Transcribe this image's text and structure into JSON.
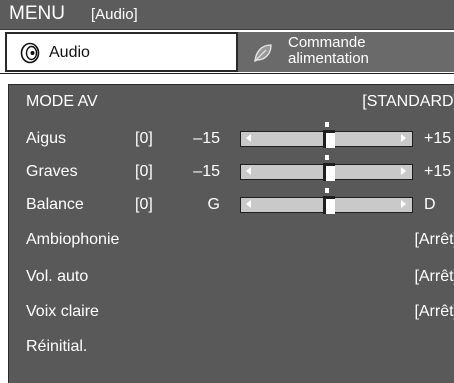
{
  "title_bar": {
    "menu": "MENU",
    "submenu": "[Audio]"
  },
  "tabs": [
    {
      "label": "Audio",
      "icon": "speaker-icon",
      "selected": true
    },
    {
      "label": "Commande alimentation",
      "icon": "leaf-icon",
      "selected": false
    }
  ],
  "settings": {
    "mode_av": {
      "label": "MODE AV",
      "value": "[STANDARD]"
    },
    "aigus": {
      "label": "Aigus",
      "current": "[0]",
      "min": "–15",
      "max": "+15",
      "level": 0.5
    },
    "graves": {
      "label": "Graves",
      "current": "[0]",
      "min": "–15",
      "max": "+15",
      "level": 0.5
    },
    "balance": {
      "label": "Balance",
      "current": "[0]",
      "min": "G",
      "max": "D",
      "level": 0.5
    },
    "ambiophonie": {
      "label": "Ambiophonie",
      "value": "[Arrêt]"
    },
    "vol_auto": {
      "label": "Vol. auto",
      "value": "[Arrêt]"
    },
    "voix_claire": {
      "label": "Voix claire",
      "value": "[Arrêt]"
    },
    "reinitial": {
      "label": "Réinitial."
    }
  },
  "colors": {
    "title_bar": "#5c5c5c",
    "panel": "#595959",
    "inactive_tab": "#6a6a6a",
    "slider_track": "#c9c9c9",
    "text": "#ffffff"
  }
}
